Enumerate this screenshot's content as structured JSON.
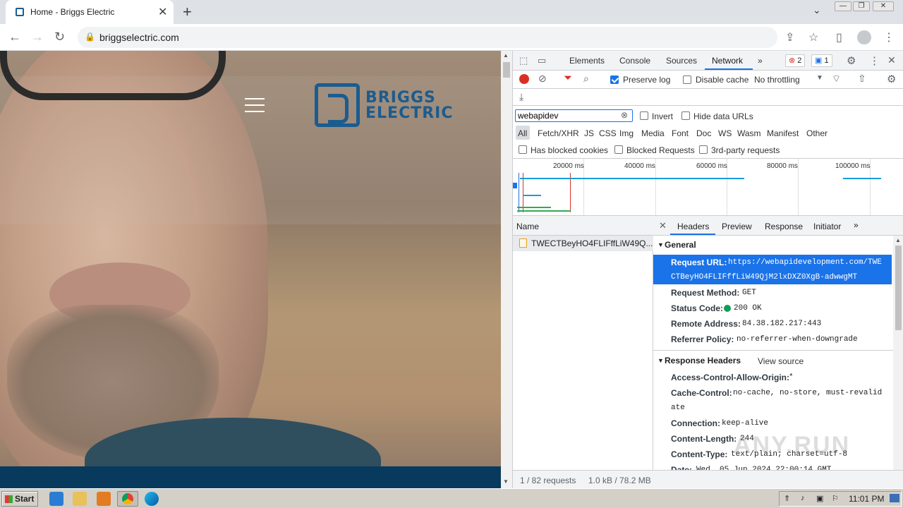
{
  "browser": {
    "tab_title": "Home - Briggs Electric",
    "url": "briggselectric.com",
    "tab_close": "✕",
    "new_tab": "+",
    "win_minimize": "—",
    "win_restore": "❐",
    "win_close": "✕"
  },
  "site": {
    "logo_line1": "BRIGGS",
    "logo_line2": "ELECTRIC"
  },
  "devtools": {
    "tabs": [
      "Elements",
      "Console",
      "Sources",
      "Network"
    ],
    "more_tabs": "»",
    "error_count": "2",
    "message_count": "1",
    "preserve_log": "Preserve log",
    "disable_cache": "Disable cache",
    "throttling": "No throttling",
    "filter_value": "webapidev",
    "invert": "Invert",
    "hide_data_urls": "Hide data URLs",
    "resource_types": [
      "All",
      "Fetch/XHR",
      "JS",
      "CSS",
      "Img",
      "Media",
      "Font",
      "Doc",
      "WS",
      "Wasm",
      "Manifest",
      "Other"
    ],
    "has_blocked_cookies": "Has blocked cookies",
    "blocked_requests": "Blocked Requests",
    "third_party": "3rd-party requests",
    "timeline_labels": [
      "20000 ms",
      "40000 ms",
      "60000 ms",
      "80000 ms",
      "100000 ms"
    ],
    "name_header": "Name",
    "request_name": "TWECTBeyHO4FLIFffLiW49Q...",
    "status_requests": "1 / 82 requests",
    "status_size": "1.0 kB / 78.2 MB",
    "detail_tabs": [
      "Headers",
      "Preview",
      "Response",
      "Initiator"
    ],
    "detail_more": "»",
    "general_title": "General",
    "request_url_label": "Request URL:",
    "request_url_line1": "https://webapidevelopment.com/TWE",
    "request_url_line2": "CTBeyHO4FLIFffLiW49QjM2lxDXZ0XgB-adwwgMT",
    "request_method_label": "Request Method:",
    "request_method": "GET",
    "status_code_label": "Status Code:",
    "status_code": "200 OK",
    "remote_address_label": "Remote Address:",
    "remote_address": "84.38.182.217:443",
    "referrer_policy_label": "Referrer Policy:",
    "referrer_policy": "no-referrer-when-downgrade",
    "response_headers_title": "Response Headers",
    "view_source": "View source",
    "acao_label": "Access-Control-Allow-Origin:",
    "acao": "*",
    "cache_control_label": "Cache-Control:",
    "cache_control_1": "no-cache, no-store, must-revalid",
    "cache_control_2": "ate",
    "connection_label": "Connection:",
    "connection": "keep-alive",
    "content_length_label": "Content-Length:",
    "content_length": "244",
    "content_type_label": "Content-Type:",
    "content_type": "text/plain; charset=utf-8",
    "date_label": "Date:",
    "date": "Wed, 05 Jun 2024 22:00:14 GMT"
  },
  "watermark": "ANY.RUN",
  "taskbar": {
    "start": "Start",
    "clock": "11:01 PM"
  },
  "colors": {
    "accent": "#1a73e8",
    "brand": "#1b5c8f",
    "record": "#d93025",
    "status_ok": "#0f9d58"
  }
}
